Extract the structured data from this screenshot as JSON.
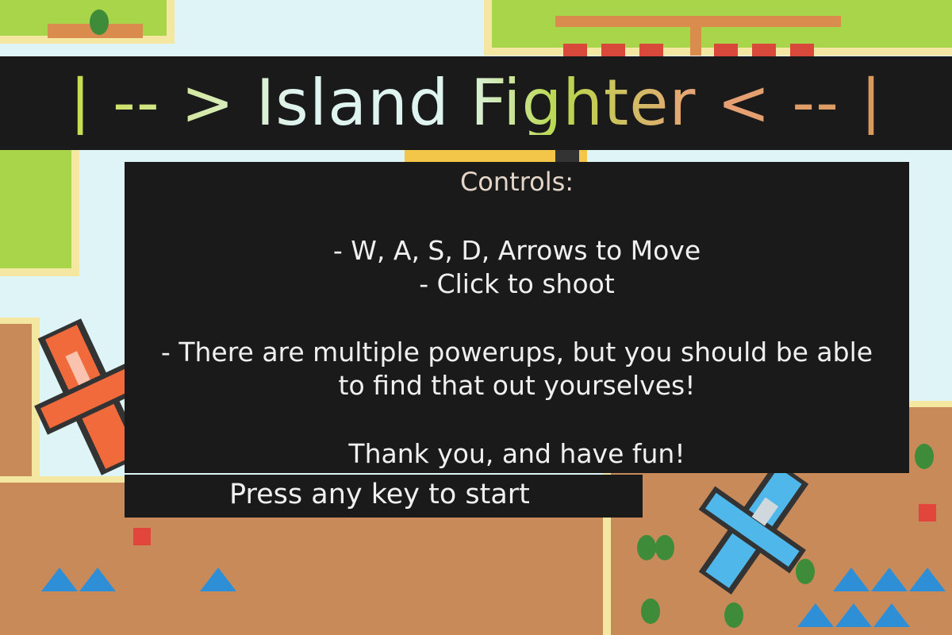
{
  "title": "| -- > Island Fighter < -- |",
  "controls": {
    "heading": "Controls:",
    "line1": "- W, A, S, D, Arrows to Move",
    "line2": "- Click to shoot",
    "line3": "- There are multiple powerups, but you should be able",
    "line4": "to find that out yourselves!",
    "line5": "Thank you, and have fun!"
  },
  "prompt": "Press any key to start",
  "colors": {
    "sea": "#dff4f6",
    "grass": "#a9d54a",
    "sand": "#f4e7a1",
    "dirt": "#c98a5a",
    "overlay": "#1a1a1a",
    "enemy_plane": "#f06a3b",
    "player_plane": "#4fb7ea"
  },
  "sprites": [
    "tree-icon",
    "house-icon",
    "enemy-plane-icon",
    "player-plane-icon",
    "tent-icon"
  ]
}
